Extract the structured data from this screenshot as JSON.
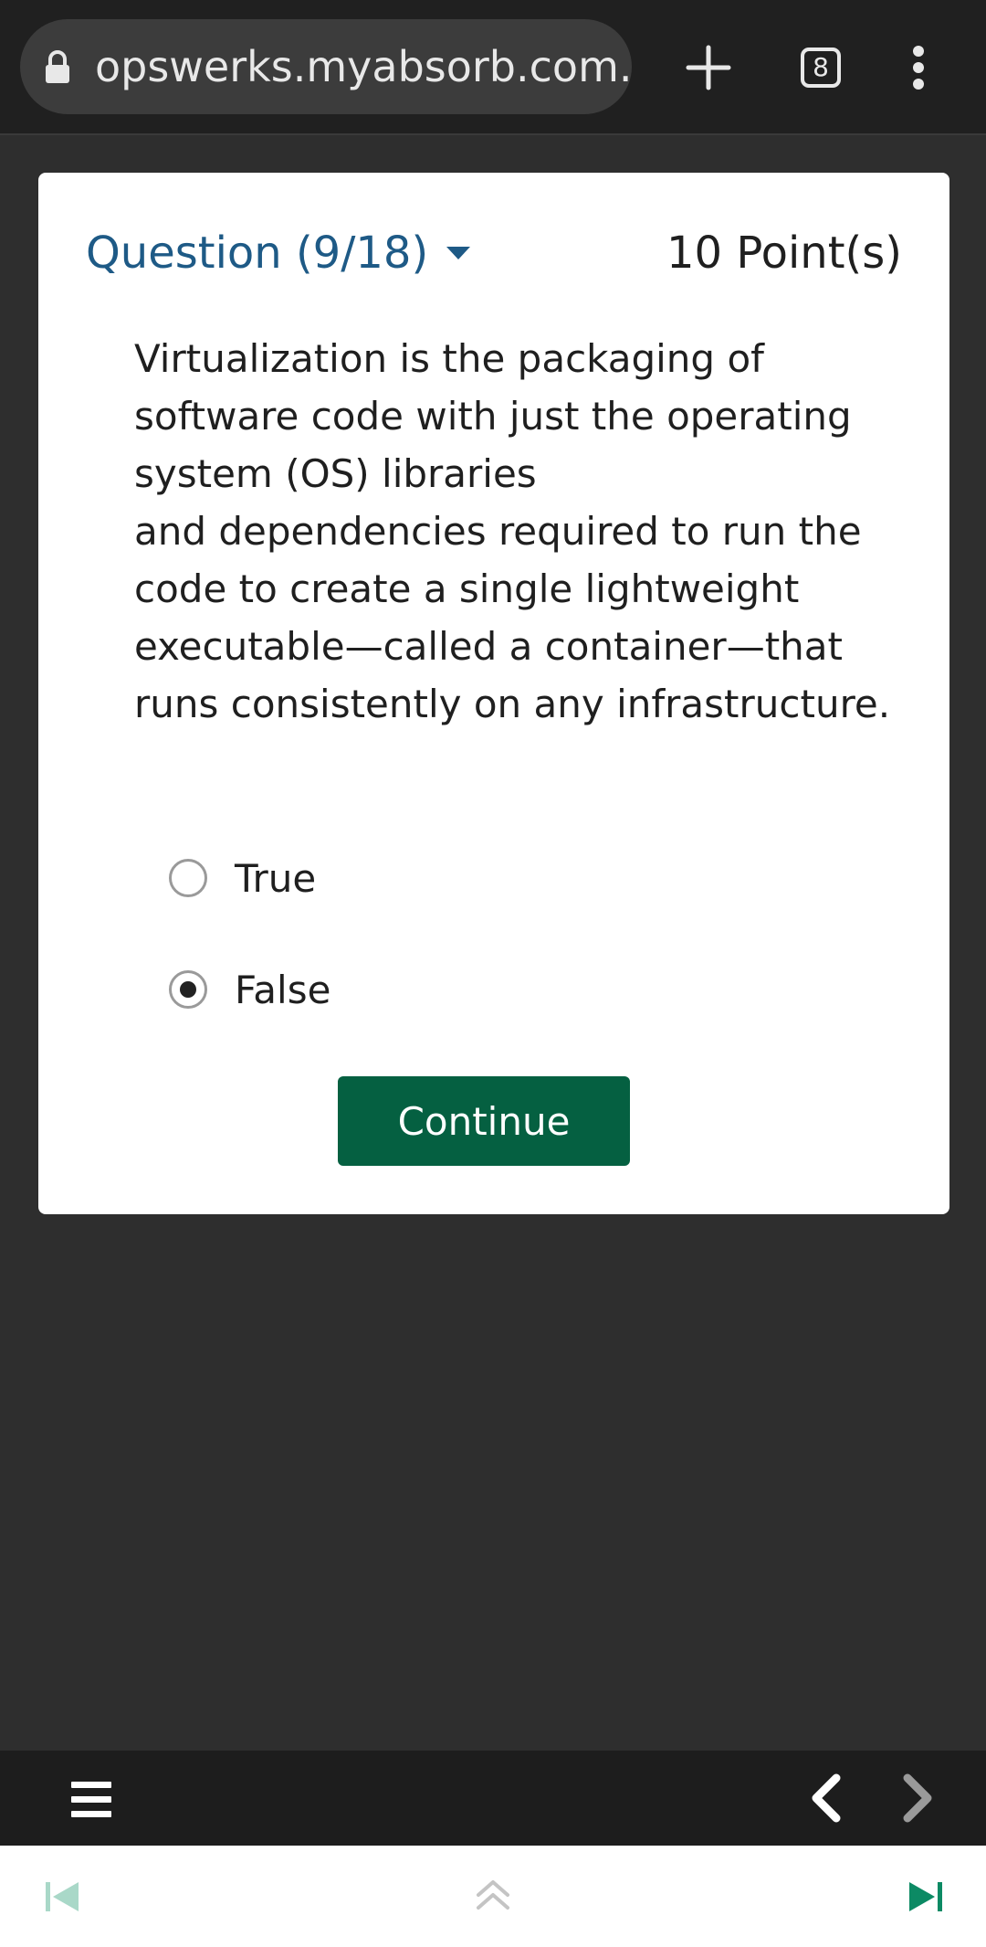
{
  "browser": {
    "url": "opswerks.myabsorb.com.au",
    "tab_count": "8"
  },
  "question": {
    "header": "Question (9/18)",
    "points": "10 Point(s)",
    "text_line1": "Virtualization is the packaging of software code with just the operating system (OS) libraries",
    "text_line2": "and dependencies required to run the code to create a single lightweight executable—called a container—that runs consistently on any infrastructure.",
    "options": [
      {
        "label": "True",
        "selected": false
      },
      {
        "label": "False",
        "selected": true
      }
    ],
    "continue_label": "Continue"
  },
  "colors": {
    "header_blue": "#1e5a86",
    "continue_green": "#056041",
    "next_green": "#0c8a64",
    "first_disabled": "#a9d8c8"
  },
  "icons": {
    "lock": "lock-icon",
    "new_tab": "plus-icon",
    "tabs": "tab-switcher-icon",
    "menu": "more-vert-icon",
    "hamburger": "hamburger-menu-icon",
    "prev": "chevron-left-icon",
    "next": "chevron-right-icon",
    "first": "skip-previous-icon",
    "up": "double-chevron-up-icon",
    "last": "skip-next-icon"
  }
}
